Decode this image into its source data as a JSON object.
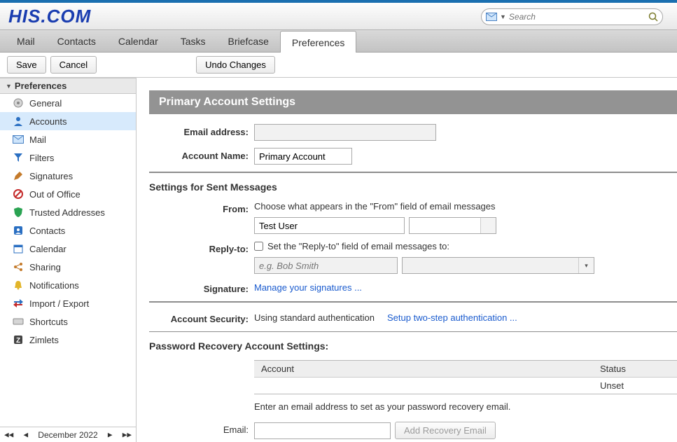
{
  "header": {
    "logo": "HIS.COM",
    "search_placeholder": "Search"
  },
  "tabs": {
    "mail": "Mail",
    "contacts": "Contacts",
    "calendar": "Calendar",
    "tasks": "Tasks",
    "briefcase": "Briefcase",
    "preferences": "Preferences"
  },
  "toolbar": {
    "save": "Save",
    "cancel": "Cancel",
    "undo": "Undo Changes"
  },
  "sidebar": {
    "heading": "Preferences",
    "items": [
      {
        "label": "General"
      },
      {
        "label": "Accounts"
      },
      {
        "label": "Mail"
      },
      {
        "label": "Filters"
      },
      {
        "label": "Signatures"
      },
      {
        "label": "Out of Office"
      },
      {
        "label": "Trusted Addresses"
      },
      {
        "label": "Contacts"
      },
      {
        "label": "Calendar"
      },
      {
        "label": "Sharing"
      },
      {
        "label": "Notifications"
      },
      {
        "label": "Import / Export"
      },
      {
        "label": "Shortcuts"
      },
      {
        "label": "Zimlets"
      }
    ],
    "date": "December 2022"
  },
  "primary": {
    "heading": "Primary Account Settings",
    "email_label": "Email address:",
    "email_value": "",
    "name_label": "Account Name:",
    "name_value": "Primary Account"
  },
  "sent": {
    "heading": "Settings for Sent Messages",
    "from_label": "From:",
    "from_help": "Choose what appears in the \"From\" field of email messages",
    "from_name": "Test User",
    "replyto_label": "Reply-to:",
    "replyto_check": "Set the \"Reply-to\" field of email messages to:",
    "replyto_placeholder": "e.g. Bob Smith",
    "sig_label": "Signature:",
    "sig_link": "Manage your signatures ..."
  },
  "security": {
    "label": "Account Security:",
    "status": "Using standard authentication",
    "link": "Setup two-step authentication ..."
  },
  "recovery": {
    "heading": "Password Recovery Account Settings:",
    "col_account": "Account",
    "col_status": "Status",
    "row_status": "Unset",
    "help": "Enter an email address to set as your password recovery email.",
    "email_label": "Email:",
    "btn": "Add Recovery Email"
  }
}
